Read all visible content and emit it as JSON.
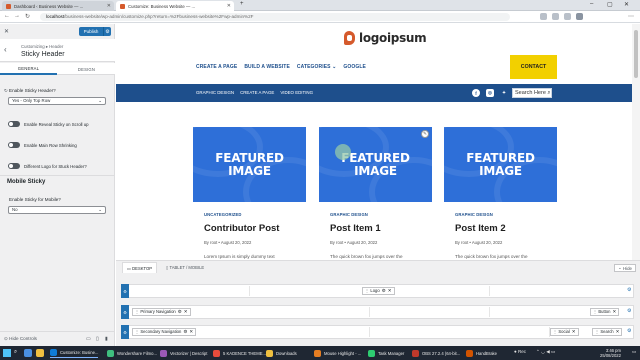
{
  "browser": {
    "tabs": [
      {
        "label": "Dashboard ‹ Business Website — ..."
      },
      {
        "label": "Customize: Business Website — ..."
      }
    ],
    "url_host": "localhost",
    "url_path": "/business-website/wp-admin/customize.php?return=%2Fbusiness-website%2Fwp-admin%2F"
  },
  "sidebar": {
    "publish_label": "Publish",
    "breadcrumb": "Customizing ▸ Header",
    "section_title": "Sticky Header",
    "tab_general": "GENERAL",
    "tab_design": "DESIGN",
    "enable_sticky_label": "Enable Sticky Header?",
    "enable_sticky_value": "Yes - Only Top Row",
    "toggle_reveal": "Enable Reveal Sticky on Scroll up",
    "toggle_shrink": "Enable Main Row Shrinking",
    "toggle_logo": "Different Logo for Stuck Header?",
    "mobile_sticky_heading": "Mobile Sticky",
    "enable_mobile_label": "Enable Sticky for Mobile?",
    "enable_mobile_value": "No",
    "hide_controls": "Hide Controls"
  },
  "preview": {
    "logo_text": "logoipsum",
    "main_nav": [
      "CREATE A PAGE",
      "BUILD A WEBSITE",
      "CATEGORIES ⌄",
      "GOOGLE"
    ],
    "contact_label": "CONTACT",
    "sub_nav": [
      "GRAPHIC DESIGN",
      "CREATE A PAGE",
      "VIDEO EDITING"
    ],
    "social_icons": [
      "facebook-icon",
      "instagram-icon",
      "twitter-icon"
    ],
    "search_placeholder": "Search Here",
    "cards": [
      {
        "image_text": "FEATURED IMAGE",
        "category": "UNCATEGORIZED",
        "title": "Contributor Post",
        "meta": "By root • August 20, 2022",
        "excerpt": "Lorem Ipsum is simply dummy text"
      },
      {
        "image_text": "FEATURED IMAGE",
        "category": "GRAPHIC DESIGN",
        "title": "Post Item 1",
        "meta": "By root • August 20, 2022",
        "excerpt": "The quick brown fox jumps over the"
      },
      {
        "image_text": "FEATURED IMAGE",
        "category": "GRAPHIC DESIGN",
        "title": "Post Item 2",
        "meta": "By root • August 20, 2022",
        "excerpt": "The quick brown fox jumps over the"
      }
    ]
  },
  "builder": {
    "tab_desktop": "DESKTOP",
    "tab_tablet": "TABLET / MOBILE",
    "hide_label": "Hide",
    "chip_logo": "Logo",
    "chip_primary_nav": "Primary Navigation",
    "chip_button": "Button",
    "chip_secondary_nav": "Secondary Navigation",
    "chip_social": "Social",
    "chip_search": "Search"
  },
  "taskbar": {
    "search_label": "Type here to search",
    "apps": [
      "Customize: Busine...",
      "Wondershare Filmo...",
      "Vectorizer | Descript",
      "5 KADENCE THEME...",
      "Downloads",
      "Mouse Highlight - ...",
      "Task Manager",
      "HandBrake"
    ],
    "weather": "OBS 27.2.4 (64-bit...",
    "tray_text": "Rec",
    "time": "3:46 pm",
    "date": "25/08/2022"
  },
  "colors": {
    "wp_blue": "#2271b1",
    "site_blue": "#1e4f8c",
    "contact_yellow": "#f2d000",
    "featured_blue": "#2e6fd8"
  }
}
